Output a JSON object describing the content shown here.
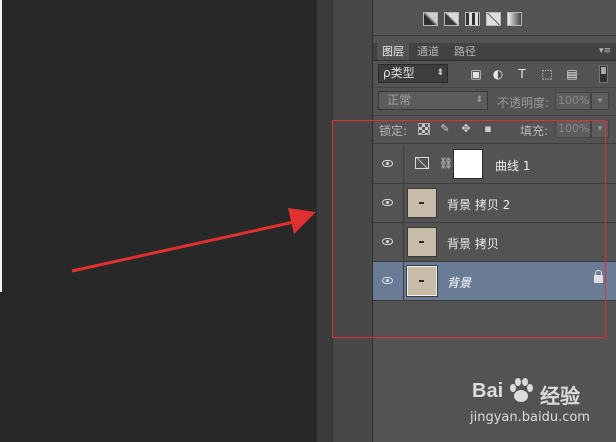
{
  "panel": {
    "tabs": [
      {
        "label": "图层",
        "active": true
      },
      {
        "label": "通道",
        "active": false
      },
      {
        "label": "路径",
        "active": false
      }
    ],
    "filter_label": "ρ类型",
    "filter_icons": [
      "image-filter-icon",
      "adjustment-filter-icon",
      "type-filter-icon",
      "shape-filter-icon",
      "smart-object-filter-icon"
    ],
    "type_glyph": "T",
    "blend_mode": "正常",
    "opacity_label": "不透明度:",
    "opacity_value": "100%",
    "lock_label": "锁定:",
    "fill_label": "填充:",
    "fill_value": "100%"
  },
  "layers": [
    {
      "name": "曲线 1",
      "kind": "curves-adjustment",
      "visible": true,
      "selected": false
    },
    {
      "name": "背景 拷贝 2",
      "kind": "pixel",
      "visible": true,
      "selected": false
    },
    {
      "name": "背景 拷贝",
      "kind": "pixel",
      "visible": true,
      "selected": false
    },
    {
      "name": "背景",
      "kind": "background",
      "visible": true,
      "selected": true,
      "locked": true
    }
  ],
  "colors": {
    "selected_layer": "#6a7b95",
    "annotation_red": "#e03030"
  },
  "watermark": {
    "brand_left": "Bai",
    "brand_right": "经验",
    "url": "jingyan.baidu.com"
  }
}
